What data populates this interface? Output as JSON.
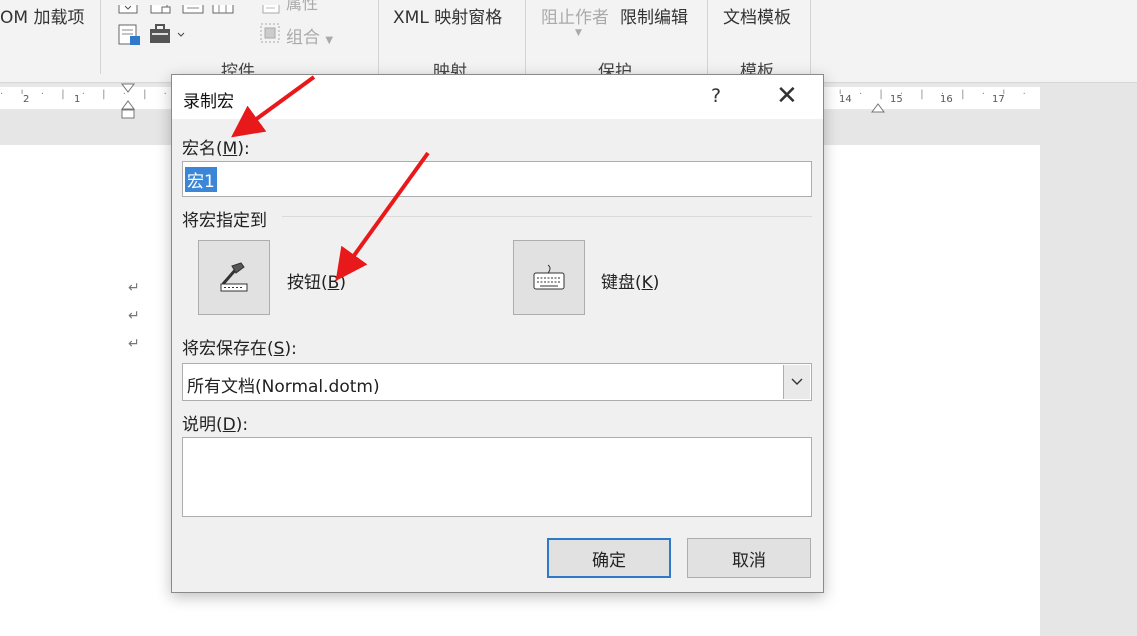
{
  "ribbon": {
    "addins_label": "OM 加载项",
    "xml_pane_label": "XML 映射窗格",
    "block_authors_label": "阻止作者",
    "restrict_editing_label": "限制编辑",
    "doc_template_label": "文档模板",
    "properties_label": "属性",
    "group_label_button": "组合",
    "groups": {
      "controls": "控件",
      "mapping": "映射",
      "protect": "保护",
      "templates": "模板"
    }
  },
  "ruler": {
    "left_numbers": [
      "2",
      "1"
    ],
    "right_numbers": [
      "14",
      "15",
      "16",
      "17"
    ]
  },
  "document": {
    "paragraph_mark": "↵"
  },
  "dialog": {
    "title": "录制宏",
    "help_glyph": "?",
    "close_glyph": "✕",
    "macro_name": {
      "label_pre": "宏名(",
      "label_key": "M",
      "label_post": "):",
      "value": "宏1"
    },
    "assign_to_label": "将宏指定到",
    "button_option": {
      "label_pre": "按钮(",
      "label_key": "B",
      "label_post": ")"
    },
    "keyboard_option": {
      "label_pre": "键盘(",
      "label_key": "K",
      "label_post": ")"
    },
    "store_in": {
      "label_pre": "将宏保存在(",
      "label_key": "S",
      "label_post": "):",
      "selected": "所有文档(Normal.dotm)"
    },
    "description": {
      "label_pre": "说明(",
      "label_key": "D",
      "label_post": "):",
      "value": ""
    },
    "ok_label": "确定",
    "cancel_label": "取消"
  },
  "colors": {
    "annotation_arrow": "#e8191b",
    "selection": "#3b86d6",
    "default_button_border": "#2f79c8"
  }
}
